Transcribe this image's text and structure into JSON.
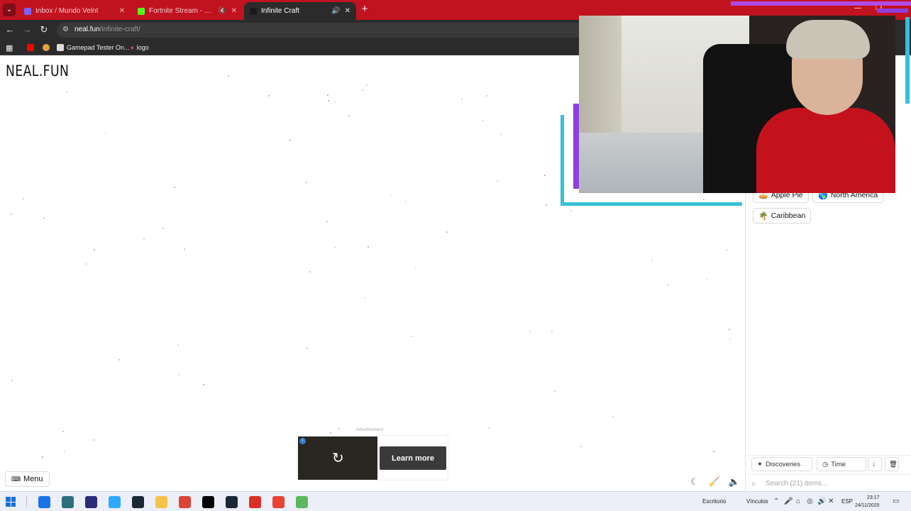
{
  "browser": {
    "tabs": [
      {
        "title": "Inbox / Mundo Velnt",
        "active": false,
        "color": "#7b61ff"
      },
      {
        "title": "Fortnite Stream - Watch Live",
        "active": false,
        "color": "#53fc18"
      },
      {
        "title": "Infinite Craft",
        "active": true,
        "color": "#1a1a1a"
      }
    ],
    "new_tab": "+",
    "url_host": "neal.fun",
    "url_path": "/infinite-craft/",
    "bookmarks": [
      {
        "label": "",
        "icon": "youtube-icon",
        "color": "#ff0000"
      },
      {
        "label": "",
        "icon": "chrome-icon",
        "color": "#e8a33d"
      },
      {
        "label": "Gamepad Tester On...",
        "icon": "gamepad-icon",
        "color": "#dddddd"
      },
      {
        "label": "logo",
        "icon": "pin-icon",
        "color": "#e05050"
      }
    ]
  },
  "page": {
    "logo": "NEAL.FUN",
    "menu_label": "Menu",
    "menu_icon": "⌨",
    "ad_label": "Advertisement",
    "ad_cta": "Learn more",
    "ad_info": "i"
  },
  "sidebar": {
    "items": [
      {
        "emoji": "🥧",
        "label": "Apple Pie"
      },
      {
        "emoji": "🌎",
        "label": "North America"
      },
      {
        "emoji": "🌴",
        "label": "Caribbean"
      }
    ],
    "discoveries_label": "Discoveries",
    "time_label": "Time",
    "search_placeholder": "Search (21) items..."
  },
  "taskbar": {
    "desktop_label": "Escritorio",
    "links_label": "Vínculos",
    "lang": "ESP",
    "time": "23:17",
    "date": "24/11/2025",
    "app_colors": [
      "#1a73e8",
      "#2d6e7e",
      "#2c2a7a",
      "#31a8ff",
      "#1b2838",
      "#f3c34a",
      "#db4437",
      "#000000",
      "#1b2838",
      "#d93025",
      "#ea4335",
      "#5cb85c"
    ]
  },
  "colors": {
    "tabbar": "#c1121f",
    "chrome_dark": "#2b2b2b",
    "accent_teal": "#36c0d8",
    "accent_purple": "#8d3fe0"
  }
}
